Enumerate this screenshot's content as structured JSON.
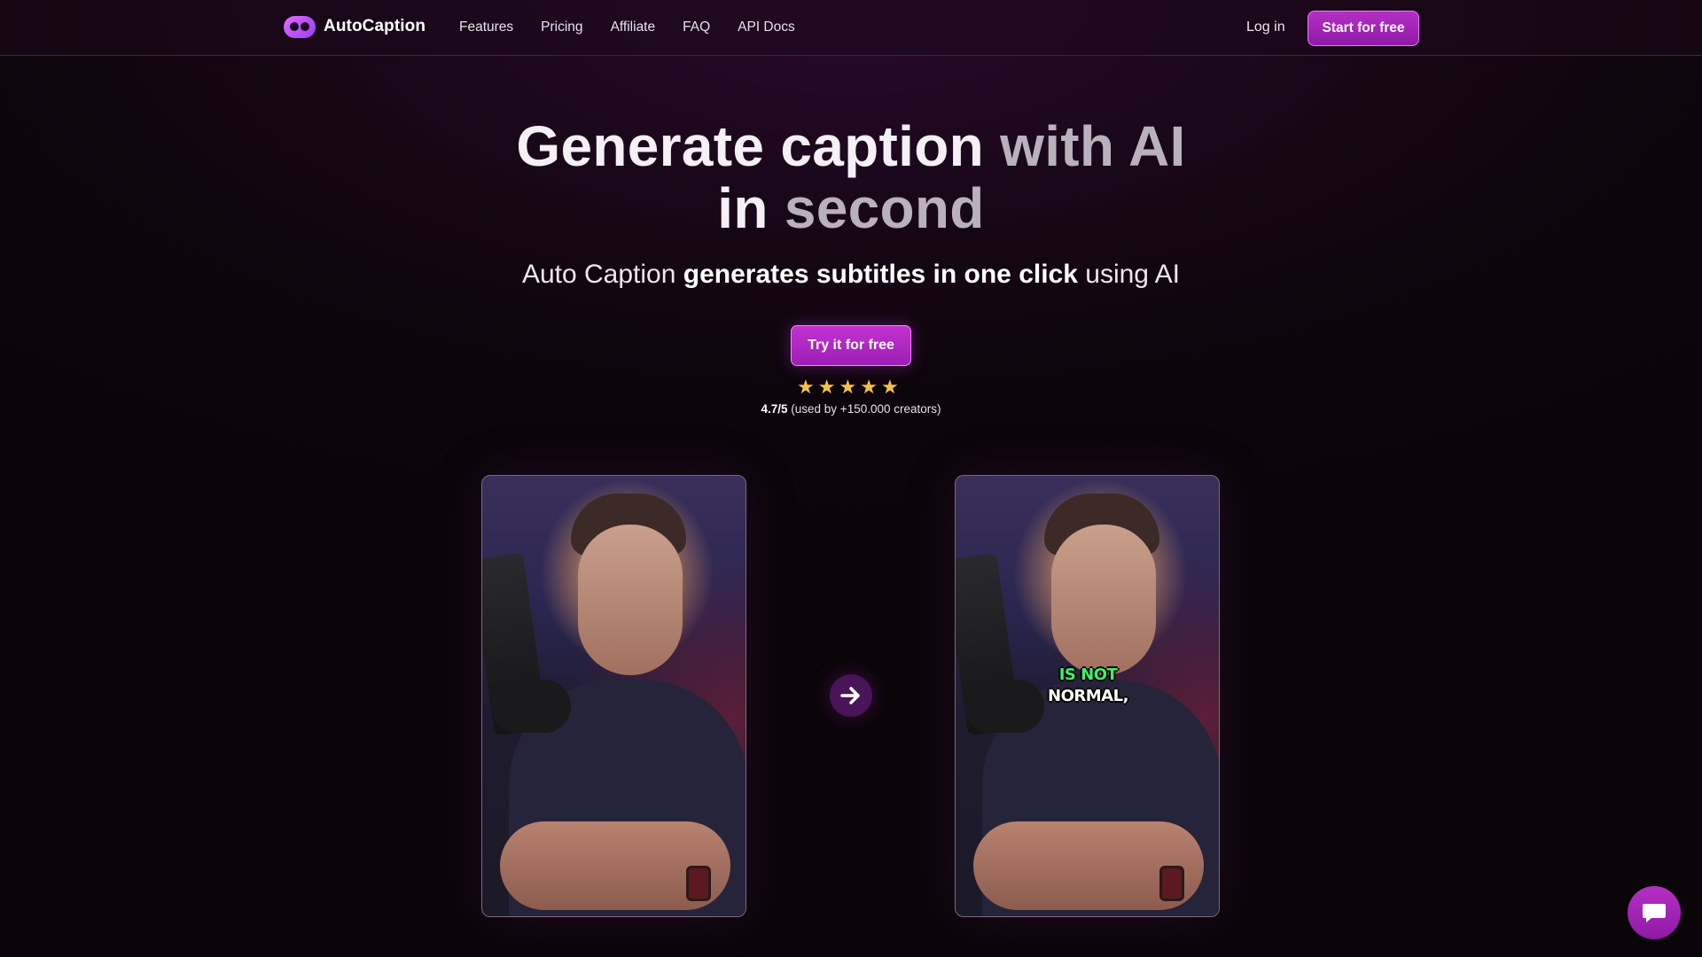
{
  "brand": {
    "name": "AutoCaption",
    "accent": "#b42fc4"
  },
  "nav": {
    "links": [
      "Features",
      "Pricing",
      "Affiliate",
      "FAQ",
      "API Docs"
    ],
    "login": "Log in",
    "start": "Start for free"
  },
  "hero": {
    "title_part1": "Generate caption",
    "title_part2": "with AI",
    "title_part3": "in",
    "title_part4": "second",
    "sub_part1": "Auto Caption",
    "sub_part2": "generates subtitles in one click",
    "sub_part3": "using AI",
    "cta": "Try it for free",
    "rating_value": "4.7/5",
    "rating_text": "(used by +150.000 creators)",
    "stars": 5
  },
  "demo": {
    "caption_line1": "IS NOT",
    "caption_line2": "NORMAL,",
    "caption_highlight_color": "#3ef26c",
    "arrow_icon": "arrow-right-icon"
  },
  "chat": {
    "icon": "chat-icon"
  }
}
